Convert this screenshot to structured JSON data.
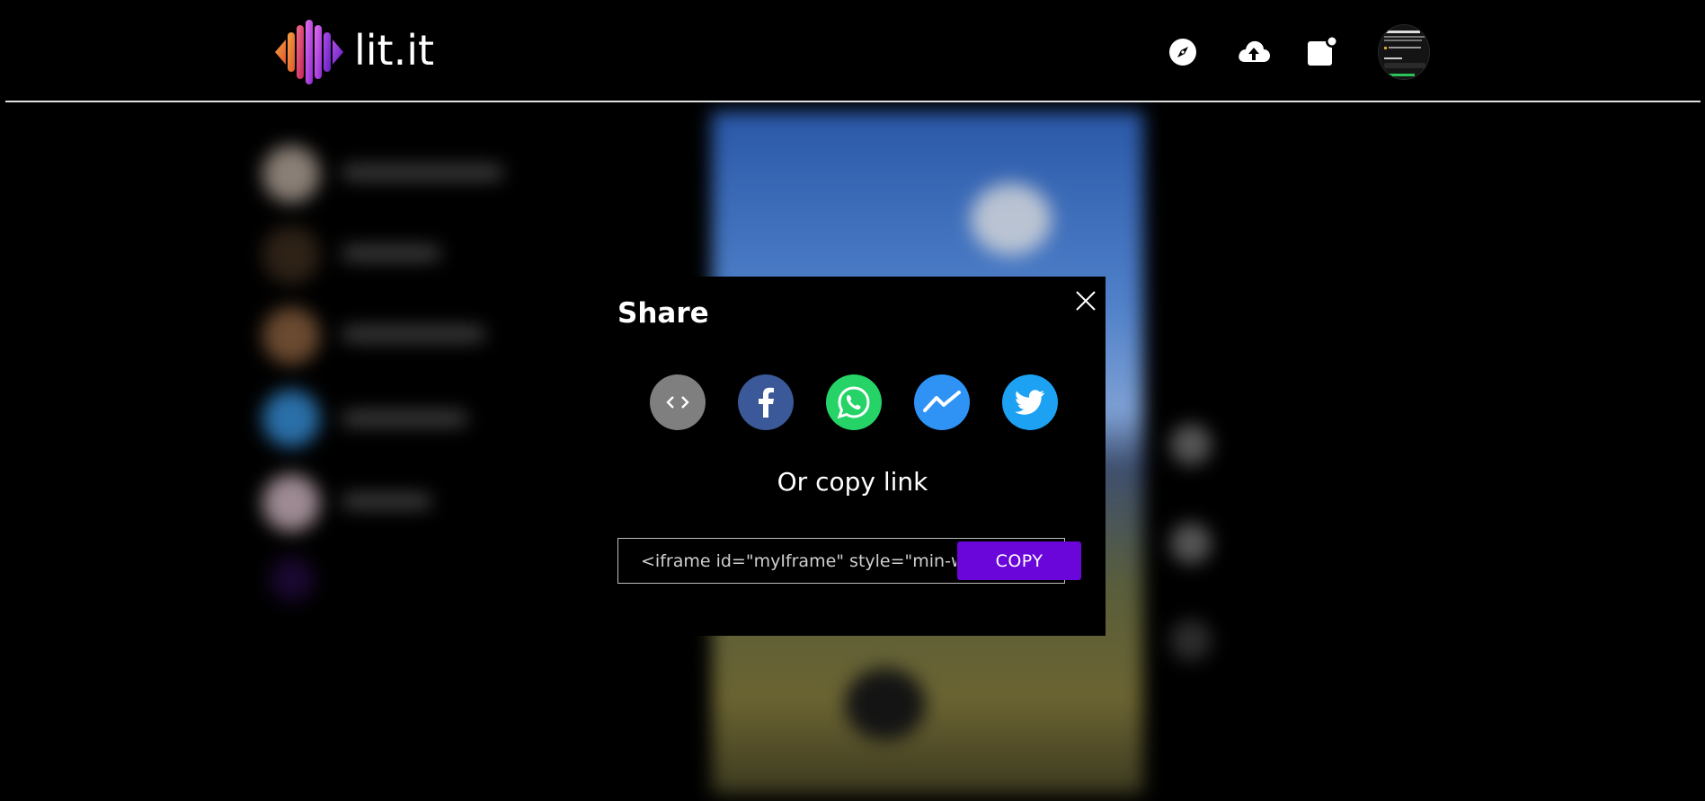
{
  "header": {
    "brand": "lit.it",
    "nav": [
      {
        "icon": "compass-icon",
        "label": "Explore"
      },
      {
        "icon": "cloud-upload-icon",
        "label": "Upload"
      },
      {
        "icon": "notification-icon",
        "label": "Notifications"
      }
    ]
  },
  "modal": {
    "title": "Share",
    "share_options": [
      {
        "name": "embed",
        "icon": "code-icon",
        "color": "#7f7f7f"
      },
      {
        "name": "facebook",
        "icon": "facebook-icon",
        "color": "#3b5998"
      },
      {
        "name": "whatsapp",
        "icon": "whatsapp-icon",
        "color": "#25d366"
      },
      {
        "name": "messenger",
        "icon": "messenger-icon",
        "color": "#2f93f5"
      },
      {
        "name": "twitter",
        "icon": "twitter-icon",
        "color": "#1da1f2"
      }
    ],
    "copy_heading": "Or copy link",
    "link_value": "<iframe id=\"myIframe\" style=\"min-w",
    "copy_label": "COPY"
  },
  "colors": {
    "accent": "#6a06d9",
    "background": "#000000"
  }
}
